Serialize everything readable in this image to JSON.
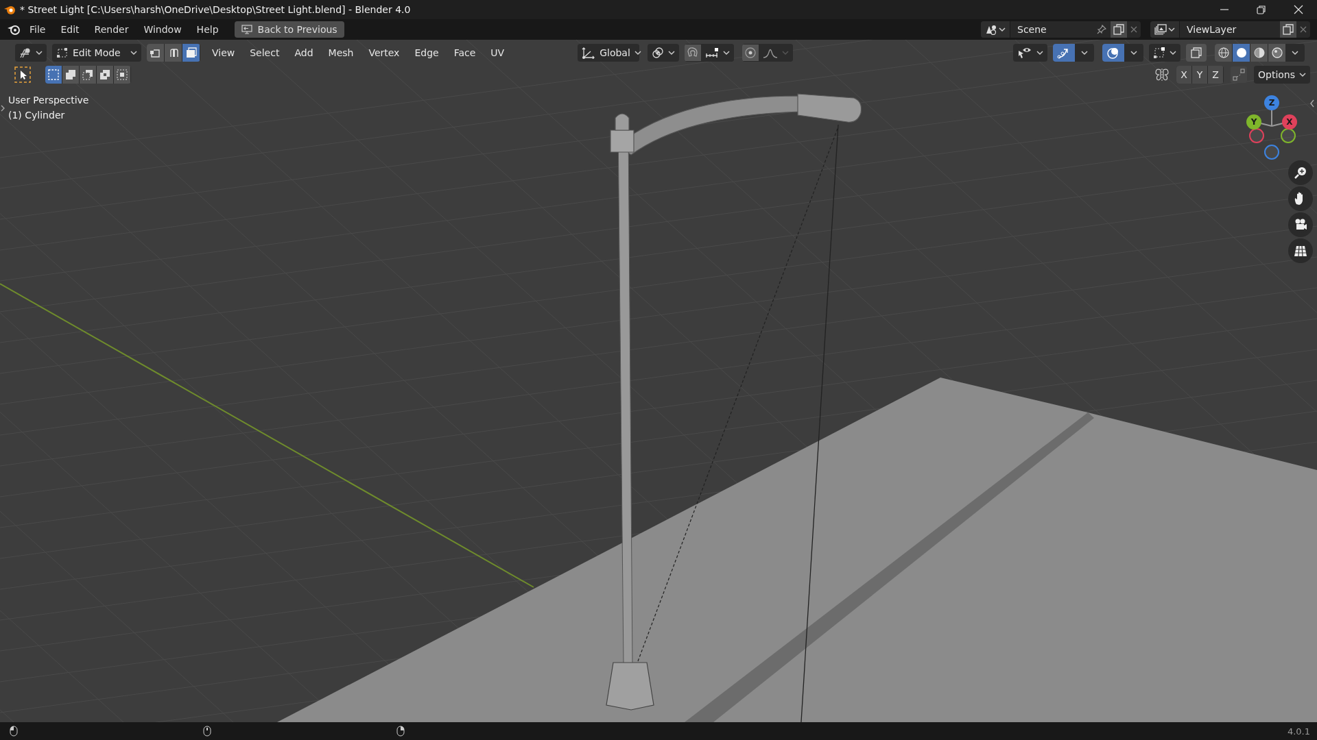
{
  "window": {
    "title": "* Street Light [C:\\Users\\harsh\\OneDrive\\Desktop\\Street Light.blend] - Blender 4.0"
  },
  "topbar": {
    "menus": [
      "File",
      "Edit",
      "Render",
      "Window",
      "Help"
    ],
    "back_button": "Back to Previous",
    "scene": "Scene",
    "view_layer": "ViewLayer"
  },
  "header": {
    "mode": "Edit Mode",
    "select_modes": [
      {
        "kind": "vertex",
        "selected": false
      },
      {
        "kind": "edge",
        "selected": false
      },
      {
        "kind": "face",
        "selected": true
      }
    ],
    "menus": [
      "View",
      "Select",
      "Add",
      "Mesh",
      "Vertex",
      "Edge",
      "Face",
      "UV"
    ],
    "orientation": "Global",
    "gizmos": {
      "on": true
    },
    "overlays": {
      "on": true
    },
    "xray": {
      "on": false
    },
    "shading": [
      {
        "kind": "wireframe",
        "selected": false
      },
      {
        "kind": "solid",
        "selected": true
      },
      {
        "kind": "material",
        "selected": false
      },
      {
        "kind": "rendered",
        "selected": false
      }
    ]
  },
  "tool_row": {
    "box_modes": [
      {
        "kind": "new",
        "selected": true
      },
      {
        "kind": "extend",
        "selected": false
      },
      {
        "kind": "subtract",
        "selected": false
      },
      {
        "kind": "invert",
        "selected": false
      },
      {
        "kind": "intersect",
        "selected": false
      }
    ],
    "axes": [
      "X",
      "Y",
      "Z"
    ],
    "options": "Options"
  },
  "viewport": {
    "overlay_text": [
      "User Perspective",
      "(1) Cylinder"
    ],
    "gizmo_axes": [
      {
        "label": "Z",
        "color": "#3d83e0"
      },
      {
        "label": "Y",
        "color": "#7fb62b"
      },
      {
        "label": "X",
        "color": "#e0415b"
      }
    ]
  },
  "status_bar": {
    "version": "4.0.1"
  }
}
